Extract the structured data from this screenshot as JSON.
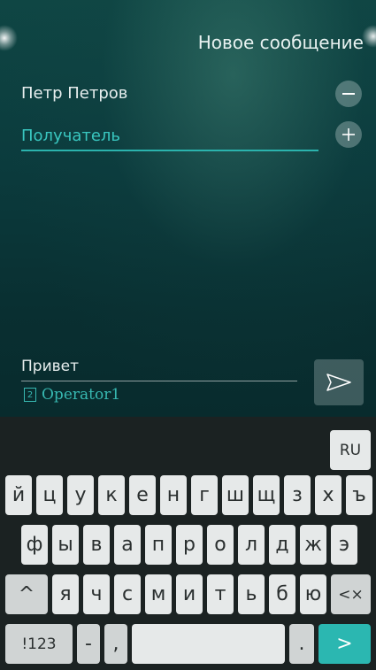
{
  "header": {
    "title": "Новое сообщение"
  },
  "contact": {
    "name": "Петр Петров"
  },
  "recipient": {
    "placeholder": "Получатель"
  },
  "message": {
    "text": "Привет"
  },
  "sim": {
    "slot": "2",
    "operator": "Operator1"
  },
  "keyboard": {
    "lang_label": "RU",
    "row1": [
      "й",
      "ц",
      "у",
      "к",
      "е",
      "н",
      "г",
      "ш",
      "щ",
      "з",
      "х",
      "ъ"
    ],
    "row2": [
      "ф",
      "ы",
      "в",
      "а",
      "п",
      "р",
      "о",
      "л",
      "д",
      "ж",
      "э"
    ],
    "row3": [
      "я",
      "ч",
      "с",
      "м",
      "и",
      "т",
      "ь",
      "б",
      "ю"
    ],
    "shift_label": "^",
    "backspace_label": "<×",
    "symbols_label": "!123",
    "dash_label": "-",
    "comma_label": ",",
    "period_label": ".",
    "enter_label": ">"
  },
  "colors": {
    "accent": "#2bb7b1",
    "background": "#0b3b3d",
    "keyboard": "#1b2222"
  }
}
